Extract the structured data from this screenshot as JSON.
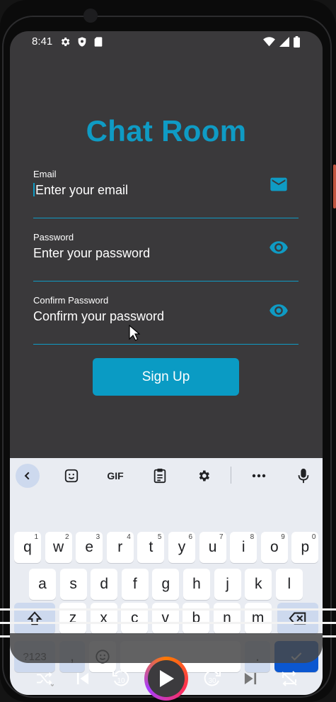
{
  "status_bar": {
    "time": "8:41",
    "left_icons": [
      "gear-icon",
      "shield-icon",
      "sd-card-icon"
    ],
    "right_icons": [
      "wifi-icon",
      "signal-icon",
      "battery-icon"
    ]
  },
  "app": {
    "title": "Chat Room",
    "accent_color": "#0f9bc4",
    "background_color": "#3a393b"
  },
  "form": {
    "email": {
      "label": "Email",
      "placeholder": "Enter your email",
      "icon": "mail-icon",
      "focused": true
    },
    "password": {
      "label": "Password",
      "placeholder": "Enter your password",
      "icon": "eye-icon"
    },
    "confirm_password": {
      "label": "Confirm Password",
      "placeholder": "Confirm your password",
      "icon": "eye-icon"
    },
    "submit_label": "Sign Up"
  },
  "keyboard": {
    "toolbar": [
      "back-icon",
      "sticker-icon",
      "GIF",
      "clipboard-icon",
      "gear-icon",
      "more-icon",
      "mic-icon"
    ],
    "row1": [
      {
        "k": "q",
        "n": "1"
      },
      {
        "k": "w",
        "n": "2"
      },
      {
        "k": "e",
        "n": "3"
      },
      {
        "k": "r",
        "n": "4"
      },
      {
        "k": "t",
        "n": "5"
      },
      {
        "k": "y",
        "n": "6"
      },
      {
        "k": "u",
        "n": "7"
      },
      {
        "k": "i",
        "n": "8"
      },
      {
        "k": "o",
        "n": "9"
      },
      {
        "k": "p",
        "n": "0"
      }
    ],
    "row2": [
      "a",
      "s",
      "d",
      "f",
      "g",
      "h",
      "j",
      "k",
      "l"
    ],
    "row3": [
      "z",
      "x",
      "c",
      "v",
      "b",
      "n",
      "m"
    ],
    "row4": {
      "symbols": "?123",
      "comma": ",",
      "period": "."
    }
  },
  "media_controls": [
    "shuffle-icon",
    "previous-icon",
    "rewind-10-icon",
    "play-icon",
    "forward-30-icon",
    "next-icon",
    "repeat-off-icon"
  ],
  "media_labels": {
    "rewind": "10",
    "forward": "30"
  }
}
